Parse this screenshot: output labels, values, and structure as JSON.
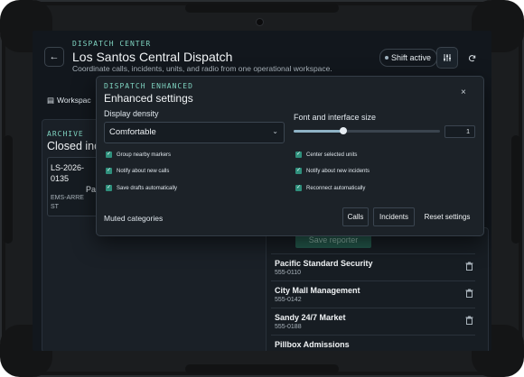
{
  "header": {
    "eyebrow": "DISPATCH CENTER",
    "title": "Los Santos Central Dispatch",
    "subtitle": "Coordinate calls, incidents, units, and radio from one operational workspace.",
    "shift_label": "Shift active",
    "back_icon": "arrow-left-icon",
    "settings_icon": "sliders-icon",
    "refresh_icon": "refresh-icon"
  },
  "workspace_tab": {
    "label": "Workspac"
  },
  "archive": {
    "eyebrow": "ARCHIVE",
    "title": "Closed inc",
    "card": {
      "id": "LS-2026-0135",
      "status": "EMS-ARREST",
      "partial": "Pa"
    }
  },
  "reporters": {
    "save_label": "Save reporter",
    "items": [
      {
        "name": "Pacific Standard Security",
        "phone": "555-0110"
      },
      {
        "name": "City Mall Management",
        "phone": "555-0142"
      },
      {
        "name": "Sandy 24/7 Market",
        "phone": "555-0188"
      },
      {
        "name": "Pillbox Admissions",
        "phone": ""
      }
    ]
  },
  "settings_modal": {
    "eyebrow": "DISPATCH ENHANCED",
    "title": "Enhanced settings",
    "close_label": "×",
    "density": {
      "label": "Display density",
      "value": "Comfortable"
    },
    "font": {
      "label": "Font and interface size",
      "value": "1",
      "level": 0.34
    },
    "options_left": [
      {
        "label": "Group nearby markers",
        "checked": true
      },
      {
        "label": "Notify about new calls",
        "checked": true
      },
      {
        "label": "Save drafts automatically",
        "checked": true
      }
    ],
    "options_right": [
      {
        "label": "Center selected units",
        "checked": true
      },
      {
        "label": "Notify about new incidents",
        "checked": true
      },
      {
        "label": "Reconnect automatically",
        "checked": true
      }
    ],
    "muted_label": "Muted categories",
    "buttons": {
      "calls": "Calls",
      "incidents": "Incidents",
      "reset": "Reset settings"
    }
  },
  "colors": {
    "accent": "#7fd3c0",
    "checkbox": "#2f8f7c",
    "background": "#12171d"
  }
}
